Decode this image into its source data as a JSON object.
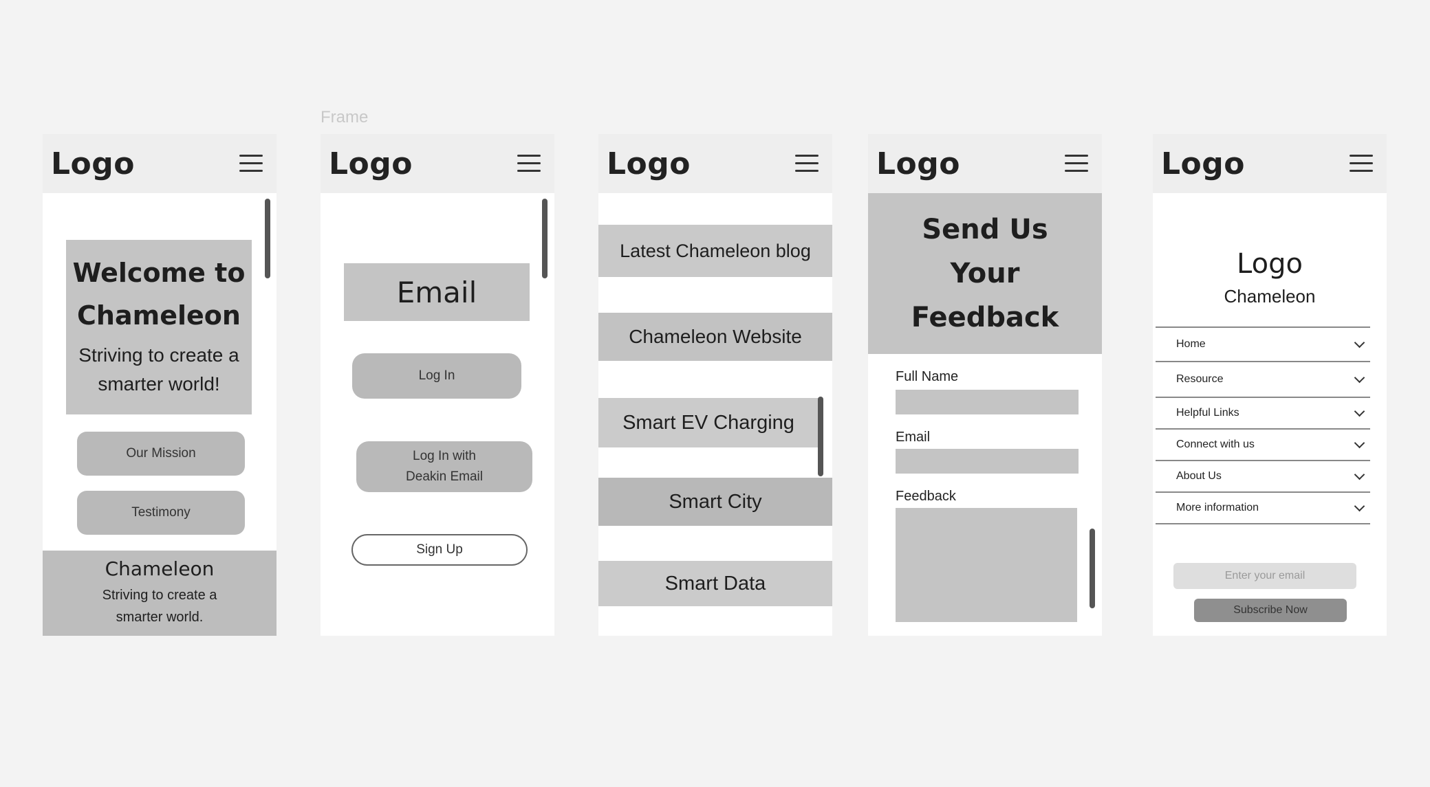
{
  "frame_label": "Frame",
  "logo_text": "Logo",
  "menu_icon": "hamburger-menu-icon",
  "screen1": {
    "hero_title": "Welcome to Chameleon",
    "hero_subtitle": "Striving to create a smarter world!",
    "mission_button": "Our Mission",
    "testimony_button": "Testimony",
    "footer_title": "Chameleon",
    "footer_subtitle": "Striving to create a smarter world."
  },
  "screen2": {
    "email_heading": "Email",
    "login_button": "Log In",
    "deakin_button": "Log In with Deakin Email",
    "signup_button": "Sign Up"
  },
  "screen3": {
    "items": [
      "Latest Chameleon blog",
      "Chameleon Website",
      "Smart EV Charging",
      "Smart City",
      "Smart Data"
    ]
  },
  "screen4": {
    "heading": "Send Us Your Feedback",
    "full_name_label": "Full Name",
    "email_label": "Email",
    "feedback_label": "Feedback"
  },
  "screen5": {
    "logo": "Logo",
    "brand": "Chameleon",
    "menu_items": [
      "Home",
      "Resource",
      "Helpful Links",
      "Connect with us",
      "About Us",
      "More information"
    ],
    "email_placeholder": "Enter your email",
    "subscribe_button": "Subscribe Now"
  }
}
